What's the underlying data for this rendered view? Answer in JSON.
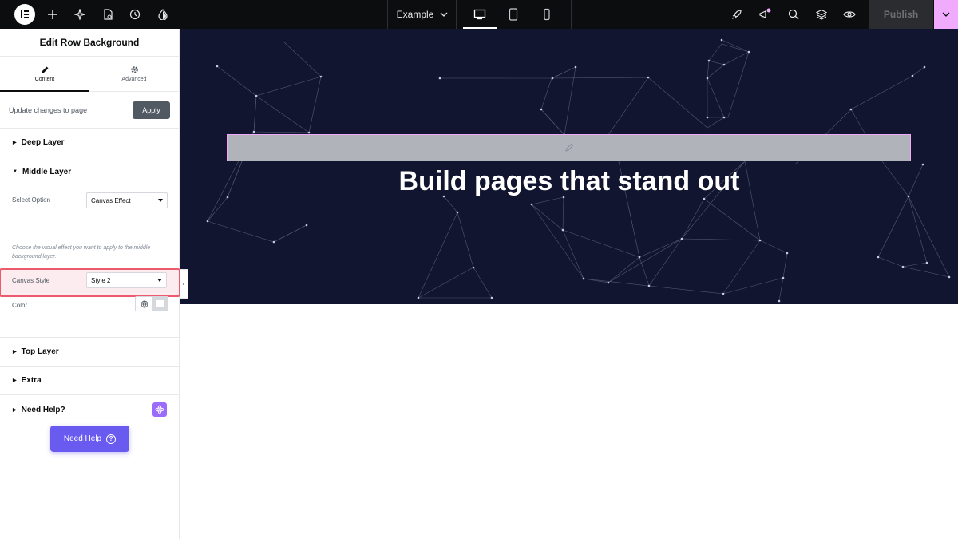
{
  "topbar": {
    "logo_icon": "elementor-logo-icon",
    "icons": [
      "plus-icon",
      "sparkle-ai-icon",
      "page-settings-icon",
      "history-icon",
      "theme-style-icon"
    ],
    "site_name": "Example",
    "devices": [
      "desktop-icon",
      "tablet-icon",
      "mobile-icon"
    ],
    "right_icons": [
      "rocket-icon",
      "whats-new-icon",
      "search-icon",
      "structure-layers-icon",
      "preview-eye-icon"
    ],
    "publish_label": "Publish",
    "accent_color": "#f0abfc"
  },
  "panel": {
    "title": "Edit Row Background",
    "tabs": [
      {
        "label": "Content",
        "icon": "pencil-icon"
      },
      {
        "label": "Advanced",
        "icon": "gear-icon"
      }
    ],
    "update_text": "Update changes to page",
    "apply_label": "Apply",
    "sections": {
      "deep_layer": "Deep Layer",
      "middle_layer": "Middle Layer",
      "top_layer": "Top Layer",
      "extra": "Extra",
      "need_help": "Need Help?"
    },
    "middle": {
      "select_option_label": "Select Option",
      "select_option_value": "Canvas Effect",
      "description": "Choose the visual effect you want to apply to the middle background layer.",
      "canvas_style_label": "Canvas Style",
      "canvas_style_value": "Style 2",
      "color_label": "Color"
    },
    "need_help_button": "Need Help",
    "need_help_button_icon": "?"
  },
  "canvas": {
    "hero_heading": "Build pages that stand out",
    "hero_background": "#121530"
  }
}
